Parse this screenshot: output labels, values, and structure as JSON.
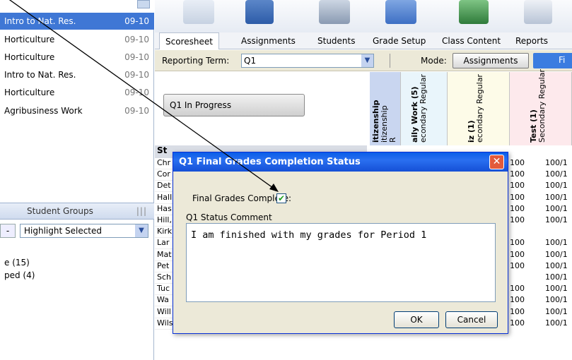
{
  "left_panel": {
    "classes": [
      {
        "name": "Intro to Nat. Res.",
        "term": "09-10",
        "selected": true
      },
      {
        "name": "Horticulture",
        "term": "09-10"
      },
      {
        "name": "Horticulture",
        "term": "09-10"
      },
      {
        "name": "Intro to Nat. Res.",
        "term": "09-10"
      },
      {
        "name": "Horticulture",
        "term": "09-10"
      },
      {
        "name": "Agribusiness Work",
        "term": "09-10"
      }
    ],
    "student_groups_label": "Student Groups",
    "grip": "|||",
    "minus": "-",
    "highlight_value": "Highlight Selected",
    "groups": [
      "e (15)",
      "ped (4)"
    ]
  },
  "tabs": [
    "Scoresheet",
    "Assignments",
    "Students",
    "Grade Setup",
    "Class Content",
    "Reports"
  ],
  "term_bar": {
    "label": "Reporting Term:",
    "value": "Q1",
    "mode_label": "Mode:",
    "mode_value": "Assignments",
    "fin_label": "Fi"
  },
  "grid": {
    "status_button": "Q1 In Progress",
    "students_header": "St",
    "columns": [
      {
        "title": "itizenship",
        "sub": "itizenship",
        "extra": "R"
      },
      {
        "title": "aily Work (5)",
        "sub": "econdary Regular"
      },
      {
        "title": "iz (1)",
        "sub": "econdary Regular"
      },
      {
        "title": "Test (1)",
        "sub": "Secondary Regular"
      }
    ],
    "students": [
      "Chr",
      "Cor",
      "Det",
      "Hall",
      "Has",
      "Hill,",
      "Kirk",
      "Lar",
      "Mat",
      "Pet",
      "Sch",
      "Tuc",
      "Wa",
      "Will",
      "Wils"
    ],
    "col_a": [
      "100",
      "100",
      "100",
      "100",
      "100",
      "100",
      "",
      "100",
      "100",
      "100",
      "",
      "100",
      "100",
      "100",
      "100"
    ],
    "col_b": [
      "100/1",
      "100/1",
      "100/1",
      "100/1",
      "100/1",
      "100/1",
      "",
      "100/1",
      "100/1",
      "100/1",
      "100/1",
      "100/1",
      "100/1",
      "100/1",
      "100/1"
    ]
  },
  "dialog": {
    "title": "Q1 Final Grades Completion Status",
    "final_label": "Final Grades Complete:",
    "checkmark": "✔",
    "comment_label": "Q1 Status Comment",
    "comment_value": "I am finished with my grades for Period 1",
    "ok": "OK",
    "cancel": "Cancel",
    "close": "✕"
  }
}
